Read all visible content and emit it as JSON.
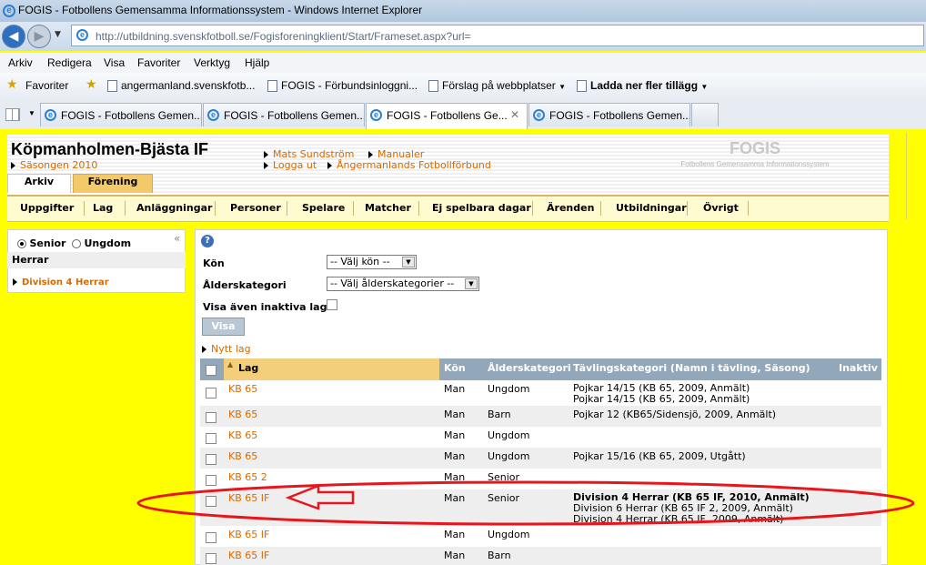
{
  "window": {
    "title": "FOGIS - Fotbollens Gemensamma Informationssystem - Windows Internet Explorer",
    "url": "http://utbildning.svenskfotboll.se/Fogisforeningklient/Start/Frameset.aspx?url="
  },
  "menu": [
    "Arkiv",
    "Redigera",
    "Visa",
    "Favoriter",
    "Verktyg",
    "Hjälp"
  ],
  "favorites": {
    "label": "Favoriter",
    "items": [
      "angermanland.svenskfotb...",
      "FOGIS - Förbundsinloggni...",
      "Förslag på webbplatser",
      "Ladda ner fler tillägg"
    ]
  },
  "tabs": [
    {
      "label": "FOGIS - Fotbollens Gemen..."
    },
    {
      "label": "FOGIS - Fotbollens Gemen..."
    },
    {
      "label": "FOGIS - Fotbollens Ge..."
    },
    {
      "label": "FOGIS - Fotbollens Gemen..."
    }
  ],
  "header": {
    "club": "Köpmanholmen-Bjästa IF",
    "season": "Säsongen 2010",
    "links": [
      "Mats Sundström",
      "Manualer",
      "Logga ut",
      "Ångermanlands Fotbollförbund"
    ],
    "logo": "FOGIS",
    "logo_sub": "Fotbollens Gemensamma Informationssystem",
    "tabs": [
      "Arkiv",
      "Förening"
    ]
  },
  "nav": [
    "Uppgifter",
    "Lag",
    "Anläggningar",
    "Personer",
    "Spelare",
    "Matcher",
    "Ej spelbara dagar",
    "Ärenden",
    "Utbildningar",
    "Övrigt"
  ],
  "left": {
    "radio_senior": "Senior",
    "radio_ungdom": "Ungdom",
    "collapse": "«",
    "section": "Herrar",
    "item": "Division 4 Herrar"
  },
  "filters": {
    "help": "?",
    "kon_label": "Kön",
    "kon_value": "-- Välj kön --",
    "alder_label": "Ålderskategori",
    "alder_value": "-- Välj ålderskategorier --",
    "inaktiva_label": "Visa även inaktiva lag",
    "visa_button": "Visa",
    "new_team": "Nytt lag"
  },
  "table": {
    "headers": {
      "lag": "Lag",
      "kon": "Kön",
      "alder": "Ålderskategori",
      "tavling": "Tävlingskategori (Namn i tävling, Säsong)",
      "inaktiv": "Inaktiv"
    },
    "rows": [
      {
        "lag": "KB 65",
        "kon": "Man",
        "alder": "Ungdom",
        "tavling": [
          "Pojkar 14/15 (KB 65, 2009, Anmält)",
          "Pojkar 14/15 (KB 65, 2009, Anmält)"
        ]
      },
      {
        "lag": "KB 65",
        "kon": "Man",
        "alder": "Barn",
        "tavling": [
          "Pojkar 12 (KB65/Sidensjö, 2009, Anmält)"
        ]
      },
      {
        "lag": "KB 65",
        "kon": "Man",
        "alder": "Ungdom",
        "tavling": []
      },
      {
        "lag": "KB 65",
        "kon": "Man",
        "alder": "Ungdom",
        "tavling": [
          "Pojkar 15/16 (KB 65, 2009, Utgått)"
        ]
      },
      {
        "lag": "KB 65 2",
        "kon": "Man",
        "alder": "Senior",
        "tavling": []
      },
      {
        "lag": "KB 65 IF",
        "kon": "Man",
        "alder": "Senior",
        "tavling": [
          "Division 4 Herrar (KB 65 IF, 2010, Anmält)",
          "Division 6 Herrar (KB 65 IF 2, 2009, Anmält)",
          "Division 4 Herrar (KB 65 IF, 2009, Anmält)"
        ]
      },
      {
        "lag": "KB 65 IF",
        "kon": "Man",
        "alder": "Ungdom",
        "tavling": []
      },
      {
        "lag": "KB 65 IF",
        "kon": "Man",
        "alder": "Barn",
        "tavling": []
      }
    ]
  },
  "colors": {
    "page_bg": "#ffff00",
    "link": "#d66a00",
    "table_header": "#93a7bb",
    "sort_header": "#f3cf7c",
    "annotation": "#e8161c"
  }
}
